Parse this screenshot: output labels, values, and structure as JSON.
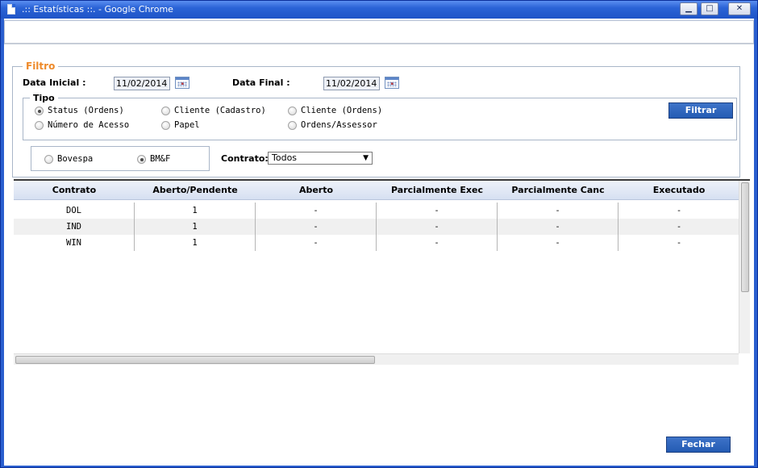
{
  "window": {
    "title": ".:: Estatísticas ::. - Google Chrome",
    "minimize_glyph": "▁",
    "maximize_glyph": "□",
    "close_glyph": "✕"
  },
  "filtro": {
    "legend": "Filtro",
    "data_inicial_label": "Data Inicial :",
    "data_inicial_value": "11/02/2014",
    "data_final_label": "Data Final :",
    "data_final_value": "11/02/2014",
    "tipo": {
      "legend": "Tipo",
      "options": [
        {
          "label": "Status (Ordens)",
          "checked": true
        },
        {
          "label": "Cliente (Cadastro)",
          "checked": false
        },
        {
          "label": "Cliente (Ordens)",
          "checked": false
        },
        {
          "label": "Número de Acesso",
          "checked": false
        },
        {
          "label": "Papel",
          "checked": false
        },
        {
          "label": "Ordens/Assessor",
          "checked": false
        }
      ]
    },
    "filtrar_label": "Filtrar",
    "mercado": [
      {
        "label": "Bovespa",
        "checked": false
      },
      {
        "label": "BM&F",
        "checked": true
      }
    ],
    "contrato_label": "Contrato:",
    "contrato_value": "Todos"
  },
  "grid": {
    "columns": [
      "Contrato",
      "Aberto/Pendente",
      "Aberto",
      "Parcialmente Exec",
      "Parcialmente Canc",
      "Executado"
    ],
    "rows": [
      [
        "DOL",
        "1",
        "-",
        "-",
        "-",
        "-"
      ],
      [
        "IND",
        "1",
        "-",
        "-",
        "-",
        "-"
      ],
      [
        "WIN",
        "1",
        "-",
        "-",
        "-",
        "-"
      ]
    ]
  },
  "footer": {
    "fechar_label": "Fechar"
  },
  "colors": {
    "titlebar": "#2a63d6",
    "legend_accent": "#ee8a2a",
    "button": "#2f67c0"
  }
}
